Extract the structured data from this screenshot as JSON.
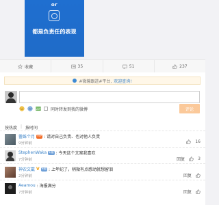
{
  "post_image": {
    "or_text": "or",
    "caption": "都是负责任的表现"
  },
  "actions": {
    "favorite_label": "收藏",
    "repost_count": "35",
    "comment_count": "51",
    "like_count": "237"
  },
  "notice": {
    "text": "#微输跟进#平台,",
    "link": "欢迎查询!"
  },
  "composer": {
    "input_value": "",
    "also_repost_label": "同时转发到我的微博",
    "submit_label": "评论"
  },
  "sort": {
    "hot_label": "按热度",
    "time_label": "按时间"
  },
  "comments": [
    {
      "name": "蕾姝个月",
      "badge": "vip",
      "text": ": 请对自己负责、也对他人负责",
      "time": "9分钟前",
      "reply": "",
      "likes": "16",
      "avatar_color": "#5b6b74"
    },
    {
      "name": "StephenWaka",
      "badge": "lvl",
      "badge_text": "1级",
      "text": ": 今天这个文案我喜欢",
      "time": "7分钟前",
      "reply": "回复",
      "likes": "3",
      "avatar_color": "#3c3c3c"
    },
    {
      "name": "神农文戴",
      "badge": "v",
      "badge_text": "V",
      "badge2_text": "9级",
      "text": ": 上年纪了，稍微有点感动就想留泪",
      "time": "2分钟前",
      "reply": "回复",
      "likes": "",
      "avatar_color": "#6a4a3a"
    },
    {
      "name": "Aeamou",
      "badge": "",
      "text": ": 海报满分",
      "time": "7分钟前",
      "reply": "回复",
      "likes": "",
      "avatar_color": "#222222"
    }
  ]
}
